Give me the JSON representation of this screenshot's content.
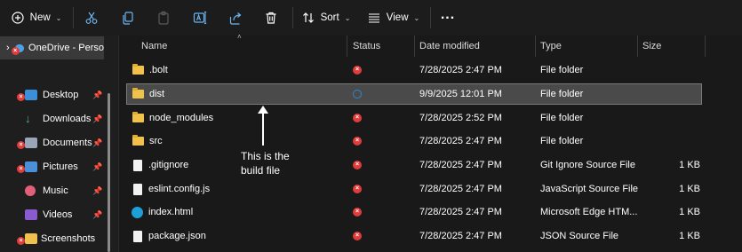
{
  "toolbar": {
    "new_label": "New",
    "sort_label": "Sort",
    "view_label": "View",
    "more_label": "..."
  },
  "sidebar": {
    "onedrive_label": "OneDrive - Perso",
    "items": [
      {
        "label": "Desktop",
        "icon": "desktop-icon"
      },
      {
        "label": "Downloads",
        "icon": "download-icon"
      },
      {
        "label": "Documents",
        "icon": "documents-icon"
      },
      {
        "label": "Pictures",
        "icon": "pictures-icon"
      },
      {
        "label": "Music",
        "icon": "music-icon"
      },
      {
        "label": "Videos",
        "icon": "videos-icon"
      },
      {
        "label": "Screenshots",
        "icon": "folder-icon"
      }
    ]
  },
  "columns": {
    "name": "Name",
    "status": "Status",
    "date": "Date modified",
    "type": "Type",
    "size": "Size"
  },
  "files": [
    {
      "name": ".bolt",
      "date": "7/28/2025 2:47 PM",
      "type": "File folder",
      "size": "",
      "icon": "folder-icon",
      "status": "error"
    },
    {
      "name": "dist",
      "date": "9/9/2025 12:01 PM",
      "type": "File folder",
      "size": "",
      "icon": "folder-icon",
      "status": "syncing"
    },
    {
      "name": "node_modules",
      "date": "7/28/2025 2:52 PM",
      "type": "File folder",
      "size": "",
      "icon": "folder-icon",
      "status": "error"
    },
    {
      "name": "src",
      "date": "7/28/2025 2:47 PM",
      "type": "File folder",
      "size": "",
      "icon": "folder-icon",
      "status": "error"
    },
    {
      "name": ".gitignore",
      "date": "7/28/2025 2:47 PM",
      "type": "Git Ignore Source File",
      "size": "1 KB",
      "icon": "gitignore-file-icon",
      "status": "error"
    },
    {
      "name": "eslint.config.js",
      "date": "7/28/2025 2:47 PM",
      "type": "JavaScript Source File",
      "size": "1 KB",
      "icon": "js-file-icon",
      "status": "error"
    },
    {
      "name": "index.html",
      "date": "7/28/2025 2:47 PM",
      "type": "Microsoft Edge HTM...",
      "size": "1 KB",
      "icon": "edge-html-icon",
      "status": "error"
    },
    {
      "name": "package.json",
      "date": "7/28/2025 2:47 PM",
      "type": "JSON Source File",
      "size": "1 KB",
      "icon": "json-file-icon",
      "status": "error"
    }
  ],
  "annotation": {
    "line1": "This is the",
    "line2": "build file"
  },
  "colors": {
    "error": "#e03c3c",
    "sync": "#2f86d6",
    "folder": "#f0c14b",
    "selection": "#4a4a4a"
  }
}
